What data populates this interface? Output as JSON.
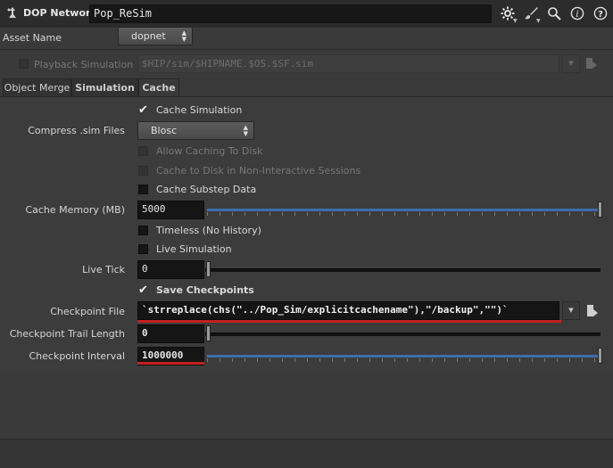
{
  "header": {
    "node_type": "DOP Network",
    "node_name": "Pop_ReSim",
    "icons": [
      "gear-icon",
      "brush-icon",
      "search-icon",
      "info-icon",
      "help-icon"
    ]
  },
  "asset": {
    "label": "Asset Name",
    "value": "dopnet"
  },
  "playback": {
    "label": "Playback Simulation",
    "path_placeholder": "$HIP/sim/$HIPNAME.$OS.$SF.sim"
  },
  "tabs": [
    {
      "label": "Object Merge",
      "active": false
    },
    {
      "label": "Simulation",
      "active": false
    },
    {
      "label": "Cache",
      "active": true
    }
  ],
  "cache": {
    "cache_simulation": {
      "label": "Cache Simulation",
      "checked": true
    },
    "compress": {
      "label": "Compress .sim Files",
      "value": "Blosc"
    },
    "allow_caching_disk": {
      "label": "Allow Caching To Disk",
      "enabled": false
    },
    "cache_disk_noninteractive": {
      "label": "Cache to Disk in Non-Interactive Sessions",
      "enabled": false
    },
    "cache_substep": {
      "label": "Cache Substep Data",
      "checked": false
    },
    "cache_memory": {
      "label": "Cache Memory (MB)",
      "value": "5000",
      "slider_fraction": 1.0
    },
    "timeless": {
      "label": "Timeless (No History)",
      "checked": false
    },
    "live_sim": {
      "label": "Live Simulation",
      "checked": false
    },
    "live_tick": {
      "label": "Live Tick",
      "value": "0",
      "slider_fraction": 0.0
    },
    "save_checkpoints": {
      "label": "Save Checkpoints",
      "checked": true
    },
    "checkpoint_file": {
      "label": "Checkpoint File",
      "value": "`strreplace(chs(\"../Pop_Sim/explicitcachename\"),\"/backup\",\"\")`"
    },
    "checkpoint_trail": {
      "label": "Checkpoint Trail Length",
      "value": "0",
      "slider_fraction": 0.0
    },
    "checkpoint_interval": {
      "label": "Checkpoint Interval",
      "value": "1000000",
      "slider_fraction": 1.0
    }
  },
  "colors": {
    "accent_blue": "#3f6ea8",
    "highlight_red": "#c42020"
  }
}
